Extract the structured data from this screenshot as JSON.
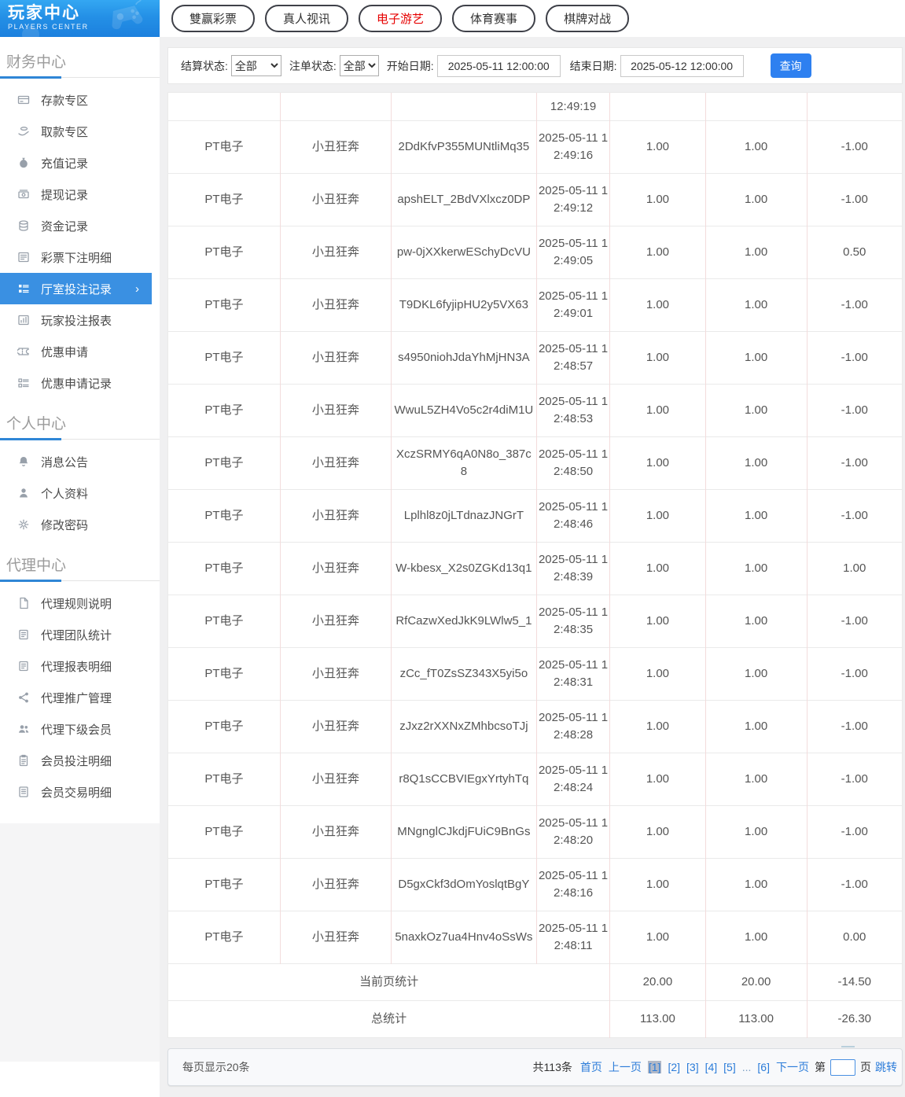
{
  "logo": {
    "title": "玩家中心",
    "subtitle": "PLAYERS CENTER"
  },
  "sidebar": {
    "sections": [
      {
        "title": "财务中心",
        "items": [
          {
            "label": "存款专区"
          },
          {
            "label": "取款专区"
          },
          {
            "label": "充值记录"
          },
          {
            "label": "提现记录"
          },
          {
            "label": "资金记录"
          },
          {
            "label": "彩票下注明细"
          },
          {
            "label": "厅室投注记录",
            "active": true,
            "chevron": "›"
          },
          {
            "label": "玩家投注报表"
          },
          {
            "label": "优惠申请"
          },
          {
            "label": "优惠申请记录"
          }
        ]
      },
      {
        "title": "个人中心",
        "items": [
          {
            "label": "消息公告"
          },
          {
            "label": "个人资料"
          },
          {
            "label": "修改密码"
          }
        ]
      },
      {
        "title": "代理中心",
        "items": [
          {
            "label": "代理规则说明"
          },
          {
            "label": "代理团队统计"
          },
          {
            "label": "代理报表明细"
          },
          {
            "label": "代理推广管理"
          },
          {
            "label": "代理下级会员"
          },
          {
            "label": "会员投注明细"
          },
          {
            "label": "会员交易明细"
          }
        ]
      }
    ]
  },
  "tabs": [
    {
      "label": "雙赢彩票"
    },
    {
      "label": "真人视讯"
    },
    {
      "label": "电子游艺",
      "active": true
    },
    {
      "label": "体育赛事"
    },
    {
      "label": "棋牌对战"
    }
  ],
  "filters": {
    "settle_status_label": "结算状态:",
    "settle_status_value": "全部",
    "order_status_label": "注单状态:",
    "order_status_value": "全部",
    "start_date_label": "开始日期:",
    "start_date_value": "2025-05-11 12:00:00",
    "end_date_label": "结束日期:",
    "end_date_value": "2025-05-12 12:00:00",
    "search_label": "查询"
  },
  "table": {
    "partial_row_time": "12:49:19",
    "rows": [
      [
        "PT电子",
        "小丑狂奔",
        "2DdKfvP355MUNtliMq35",
        "2025-05-11 12:49:16",
        "1.00",
        "1.00",
        "-1.00"
      ],
      [
        "PT电子",
        "小丑狂奔",
        "apshELT_2BdVXlxcz0DP",
        "2025-05-11 12:49:12",
        "1.00",
        "1.00",
        "-1.00"
      ],
      [
        "PT电子",
        "小丑狂奔",
        "pw-0jXXkerwESchyDcVU",
        "2025-05-11 12:49:05",
        "1.00",
        "1.00",
        "0.50"
      ],
      [
        "PT电子",
        "小丑狂奔",
        "T9DKL6fyjipHU2y5VX63",
        "2025-05-11 12:49:01",
        "1.00",
        "1.00",
        "-1.00"
      ],
      [
        "PT电子",
        "小丑狂奔",
        "s4950niohJdaYhMjHN3A",
        "2025-05-11 12:48:57",
        "1.00",
        "1.00",
        "-1.00"
      ],
      [
        "PT电子",
        "小丑狂奔",
        "WwuL5ZH4Vo5c2r4diM1U",
        "2025-05-11 12:48:53",
        "1.00",
        "1.00",
        "-1.00"
      ],
      [
        "PT电子",
        "小丑狂奔",
        "XczSRMY6qA0N8o_387c8",
        "2025-05-11 12:48:50",
        "1.00",
        "1.00",
        "-1.00"
      ],
      [
        "PT电子",
        "小丑狂奔",
        "Lplhl8z0jLTdnazJNGrT",
        "2025-05-11 12:48:46",
        "1.00",
        "1.00",
        "-1.00"
      ],
      [
        "PT电子",
        "小丑狂奔",
        "W-kbesx_X2s0ZGKd13q1",
        "2025-05-11 12:48:39",
        "1.00",
        "1.00",
        "1.00"
      ],
      [
        "PT电子",
        "小丑狂奔",
        "RfCazwXedJkK9LWlw5_1",
        "2025-05-11 12:48:35",
        "1.00",
        "1.00",
        "-1.00"
      ],
      [
        "PT电子",
        "小丑狂奔",
        "zCc_fT0ZsSZ343X5yi5o",
        "2025-05-11 12:48:31",
        "1.00",
        "1.00",
        "-1.00"
      ],
      [
        "PT电子",
        "小丑狂奔",
        "zJxz2rXXNxZMhbcsoTJj",
        "2025-05-11 12:48:28",
        "1.00",
        "1.00",
        "-1.00"
      ],
      [
        "PT电子",
        "小丑狂奔",
        "r8Q1sCCBVIEgxYrtyhTq",
        "2025-05-11 12:48:24",
        "1.00",
        "1.00",
        "-1.00"
      ],
      [
        "PT电子",
        "小丑狂奔",
        "MNgnglCJkdjFUiC9BnGs",
        "2025-05-11 12:48:20",
        "1.00",
        "1.00",
        "-1.00"
      ],
      [
        "PT电子",
        "小丑狂奔",
        "D5gxCkf3dOmYoslqtBgY",
        "2025-05-11 12:48:16",
        "1.00",
        "1.00",
        "-1.00"
      ],
      [
        "PT电子",
        "小丑狂奔",
        "5naxkOz7ua4Hnv4oSsWs",
        "2025-05-11 12:48:11",
        "1.00",
        "1.00",
        "0.00"
      ]
    ],
    "page_summary": {
      "label": "当前页统计",
      "bet": "20.00",
      "valid": "20.00",
      "winloss": "-14.50"
    },
    "total_summary": {
      "label": "总统计",
      "bet": "113.00",
      "valid": "113.00",
      "winloss": "-26.30"
    }
  },
  "pagination": {
    "per_page": "每页显示20条",
    "total": "共113条",
    "first": "首页",
    "prev": "上一页",
    "pages": [
      {
        "label": "[1]",
        "current": true
      },
      {
        "label": "[2]"
      },
      {
        "label": "[3]"
      },
      {
        "label": "[4]"
      },
      {
        "label": "[5]"
      },
      {
        "label": "...",
        "ellipsis": true
      },
      {
        "label": "[6]"
      }
    ],
    "next": "下一页",
    "jump_prefix": "第",
    "jump_suffix": "页",
    "jump_label": "跳转"
  },
  "colors": {
    "accent_blue": "#2e80f0",
    "sidebar_active_blue": "#3a90e2",
    "link_blue": "#2b7cd9",
    "active_tab_red": "#e60000"
  }
}
